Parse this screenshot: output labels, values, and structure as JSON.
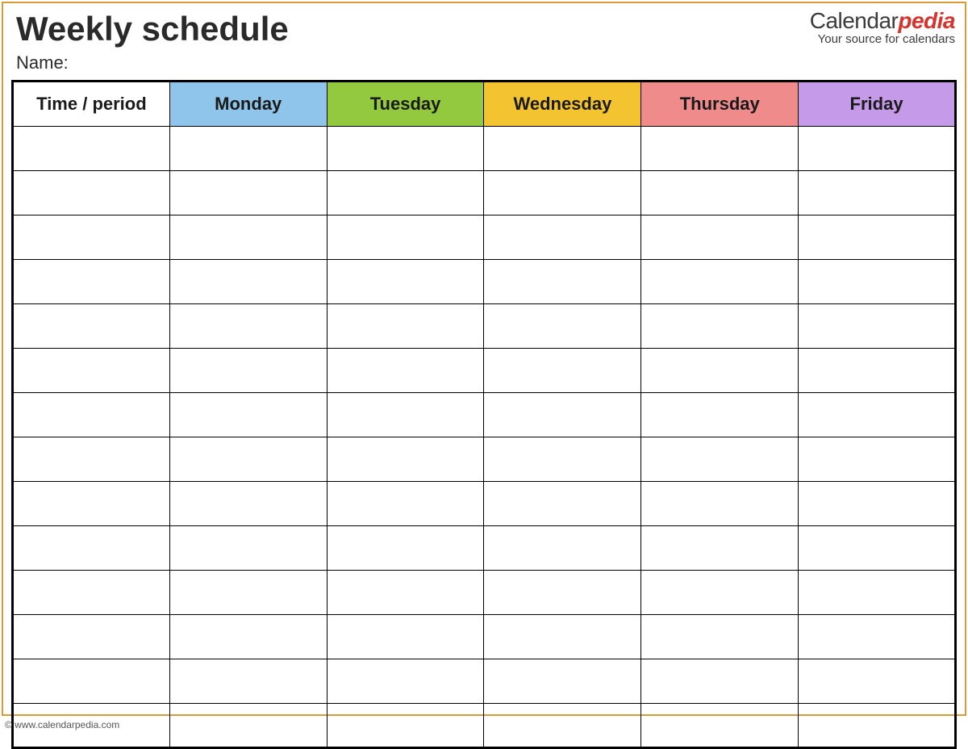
{
  "header": {
    "title": "Weekly schedule",
    "name_label": "Name:"
  },
  "logo": {
    "prefix": "Calendar",
    "accent": "pedia",
    "tagline": "Your source for calendars"
  },
  "table": {
    "time_header": "Time / period",
    "days": [
      {
        "label": "Monday",
        "color": "#8fc5ea"
      },
      {
        "label": "Tuesday",
        "color": "#93c93e"
      },
      {
        "label": "Wednesday",
        "color": "#f4c430"
      },
      {
        "label": "Thursday",
        "color": "#ef8b8b"
      },
      {
        "label": "Friday",
        "color": "#c59ae8"
      }
    ],
    "row_count": 14
  },
  "footer": {
    "copyright": "© www.calendarpedia.com"
  }
}
